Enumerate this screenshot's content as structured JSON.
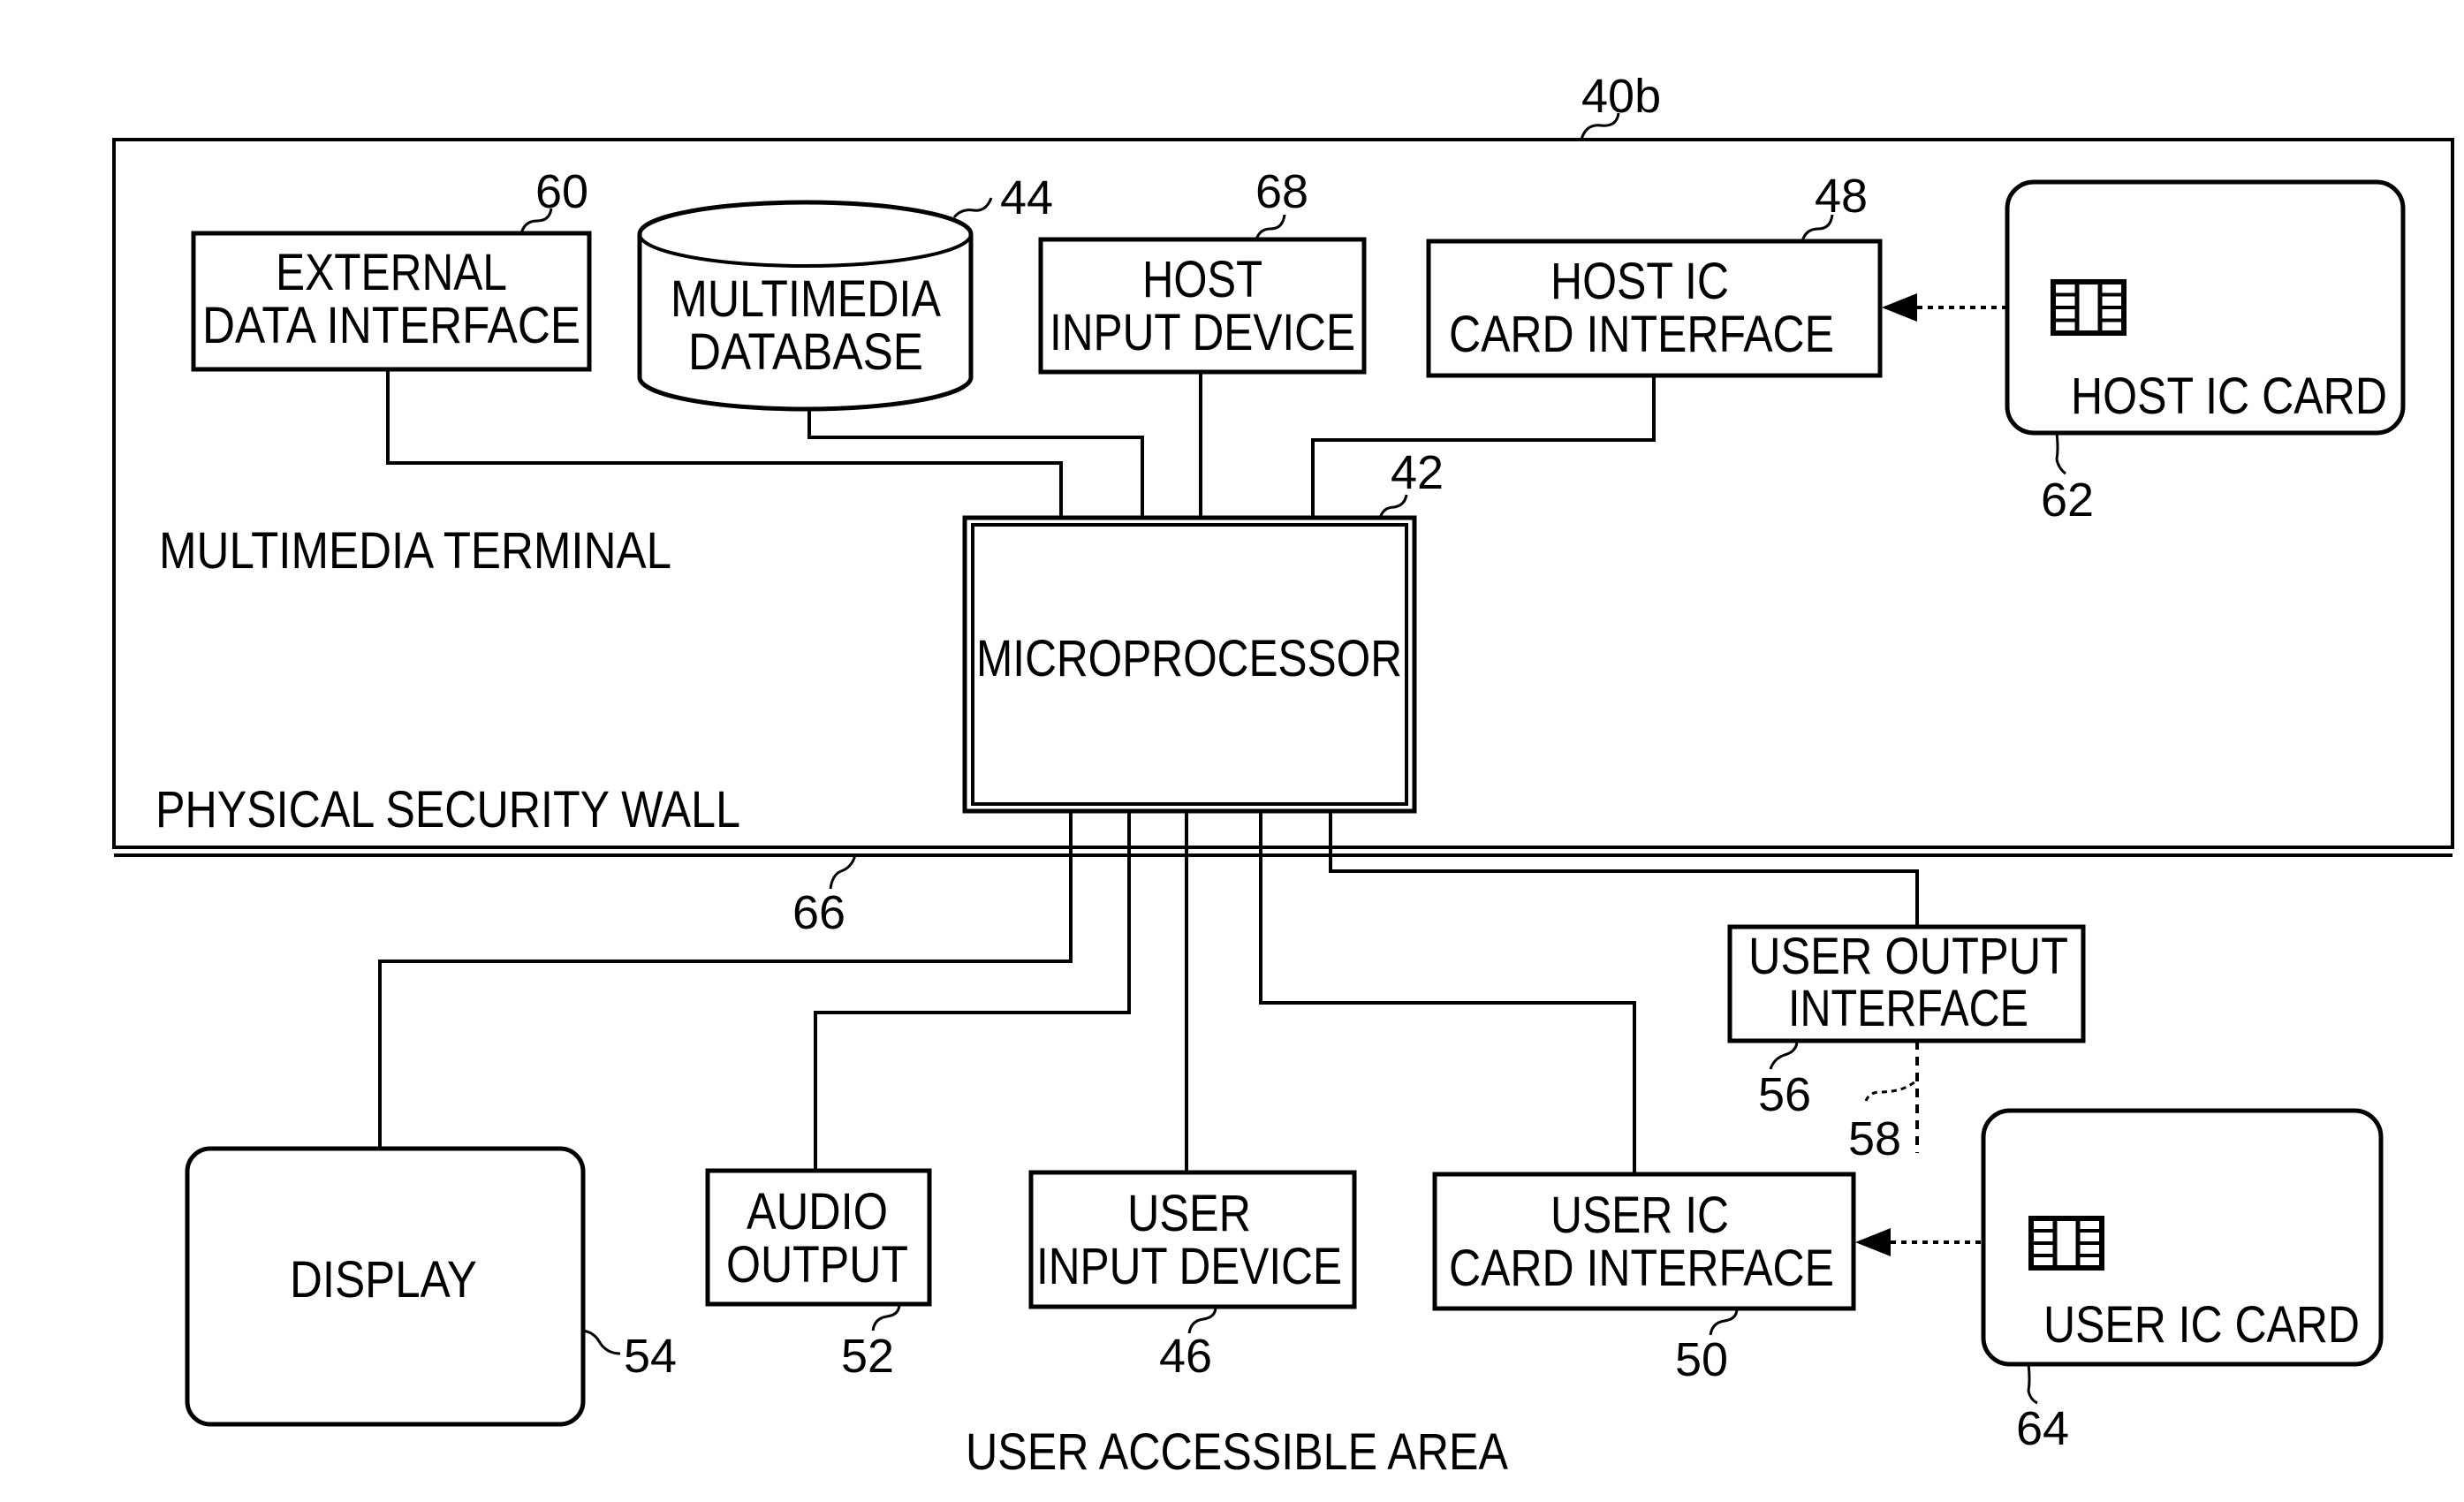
{
  "figure": {
    "reference": "40b",
    "regions": {
      "terminal": "MULTIMEDIA TERMINAL",
      "wall": "PHYSICAL SECURITY WALL",
      "wall_ref": "66",
      "user_area": "USER ACCESSIBLE AREA"
    },
    "blocks": {
      "external_data_interface": {
        "lines": [
          "EXTERNAL",
          "DATA INTERFACE"
        ],
        "ref": "60"
      },
      "multimedia_database": {
        "lines": [
          "MULTIMEDIA",
          "DATABASE"
        ],
        "ref": "44"
      },
      "host_input_device": {
        "lines": [
          "HOST",
          "INPUT DEVICE"
        ],
        "ref": "68"
      },
      "host_ic_card_interface": {
        "lines": [
          "HOST IC",
          "CARD INTERFACE"
        ],
        "ref": "48"
      },
      "host_ic_card": {
        "lines": [
          "HOST IC CARD"
        ],
        "ref": "62"
      },
      "microprocessor": {
        "lines": [
          "MICROPROCESSOR"
        ],
        "ref": "42"
      },
      "user_output_interface": {
        "lines": [
          "USER OUTPUT",
          "INTERFACE"
        ],
        "ref": "56",
        "link_ref": "58"
      },
      "display": {
        "lines": [
          "DISPLAY"
        ],
        "ref": "54"
      },
      "audio_output": {
        "lines": [
          "AUDIO",
          "OUTPUT"
        ],
        "ref": "52"
      },
      "user_input_device": {
        "lines": [
          "USER",
          "INPUT DEVICE"
        ],
        "ref": "46"
      },
      "user_ic_card_interface": {
        "lines": [
          "USER IC",
          "CARD INTERFACE"
        ],
        "ref": "50"
      },
      "user_ic_card": {
        "lines": [
          "USER IC CARD"
        ],
        "ref": "64"
      }
    },
    "icons": {
      "host_chip": "ic-chip-icon",
      "user_chip": "ic-chip-icon"
    }
  }
}
